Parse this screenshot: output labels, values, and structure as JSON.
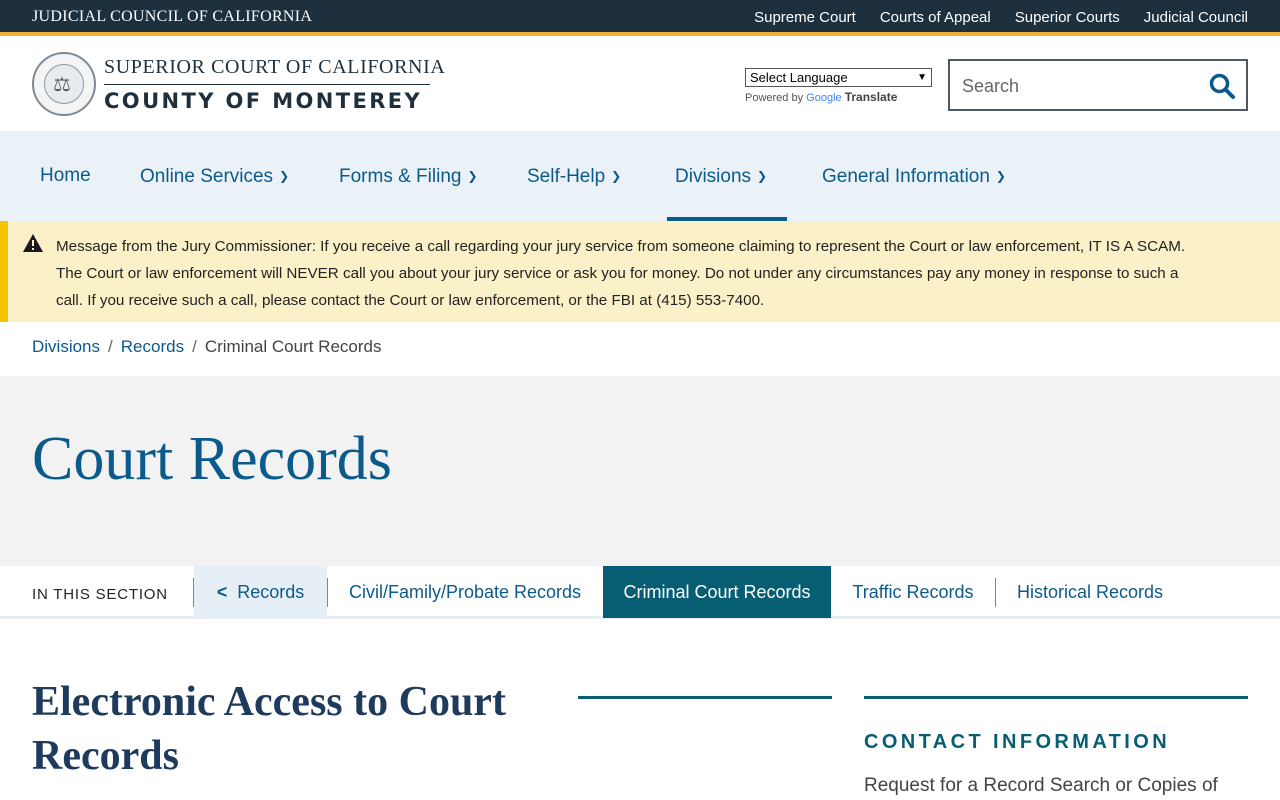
{
  "topbar": {
    "brand": "JUDICIAL COUNCIL OF CALIFORNIA",
    "links": [
      "Supreme Court",
      "Courts of Appeal",
      "Superior Courts",
      "Judicial Council"
    ]
  },
  "header": {
    "court_line1": "SUPERIOR COURT OF CALIFORNIA",
    "court_line2": "COUNTY OF MONTEREY",
    "language_select": "Select Language",
    "powered_by": "Powered by",
    "google": "Google",
    "translate": "Translate",
    "search_placeholder": "Search"
  },
  "nav": {
    "items": [
      "Home",
      "Online Services",
      "Forms & Filing",
      "Self-Help",
      "Divisions",
      "General Information"
    ],
    "active": "Divisions"
  },
  "alert": {
    "lead": "Message from the Jury Commissioner:",
    "text": " If you receive a call regarding your jury service from someone claiming to represent the Court or law enforcement, IT IS A SCAM.  The Court or law enforcement will NEVER call you about your jury service or ask you for money.  Do not under any circumstances pay any money in response to such a call.  If you receive such a call, please contact the Court or law enforcement, or the FBI at (415) 553-7400."
  },
  "breadcrumb": {
    "items": [
      "Divisions",
      "Records",
      "Criminal Court Records"
    ],
    "separator": "/"
  },
  "hero": {
    "title": "Court Records"
  },
  "section_nav": {
    "label": "IN THIS SECTION",
    "back": "Records",
    "items": [
      "Civil/Family/Probate Records",
      "Criminal Court Records",
      "Traffic Records",
      "Historical Records"
    ],
    "current": "Criminal Court Records"
  },
  "content": {
    "title": "Electronic Access to Court Records"
  },
  "sidebar": {
    "heading": "CONTACT INFORMATION",
    "text": "Request for a Record Search or Copies of"
  },
  "colors": {
    "topbar": "#1e2f3d",
    "accent": "#f2b13c",
    "link": "#0b5a8c",
    "teal": "#075e73",
    "alert_bg": "#fbf1c8",
    "alert_border": "#f4c400"
  }
}
